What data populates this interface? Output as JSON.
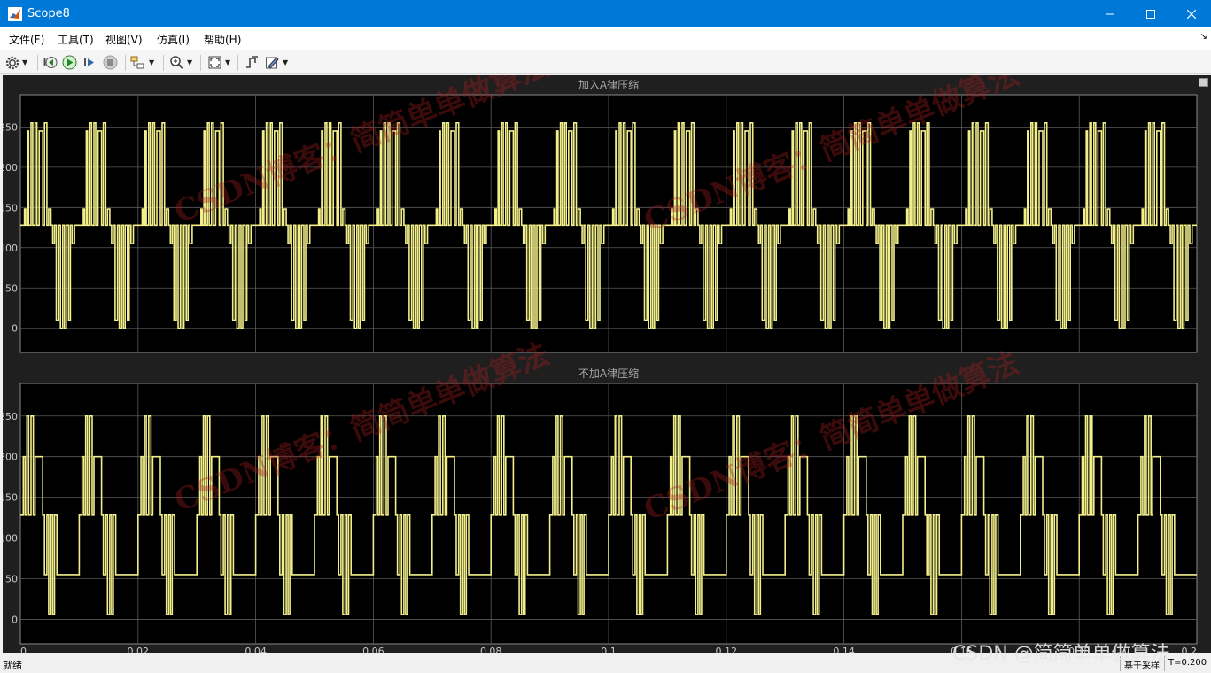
{
  "window": {
    "title": "Scope8"
  },
  "menu": [
    "文件(F)",
    "工具(T)",
    "视图(V)",
    "仿真(I)",
    "帮助(H)"
  ],
  "toolbar": {
    "buttons": [
      {
        "name": "settings-icon"
      },
      {
        "name": "step-back-icon"
      },
      {
        "name": "run-icon"
      },
      {
        "name": "step-forward-icon"
      },
      {
        "name": "stop-icon"
      },
      {
        "name": "highlight-block-icon"
      },
      {
        "name": "zoom-in-icon"
      },
      {
        "name": "autoscale-icon"
      },
      {
        "name": "triggers-icon"
      },
      {
        "name": "style-icon"
      }
    ]
  },
  "statusbar": {
    "status": "就绪",
    "sample_mode": "基于采样",
    "time": "T=0.200"
  },
  "watermark": {
    "page_text": "CSDN @简简单单做算法",
    "diagonal_text": "CSDN博客：简简单单做算法"
  },
  "colors": {
    "trace": "#f2ef8a",
    "plot_bg": "#000000",
    "panel_bg": "#1f1f1f",
    "grid": "#5a5a5a",
    "titlebar": "#0078d7"
  },
  "chart_data": [
    {
      "type": "line",
      "title": "加入A律压缩",
      "xlim": [
        0,
        0.2
      ],
      "ylim": [
        -30,
        290
      ],
      "y_ticks": [
        0,
        50,
        100,
        150,
        200,
        250
      ],
      "grid": true,
      "period": 0.02,
      "period_shape": {
        "x": [
          0,
          0.0007,
          0.0007,
          0.0009,
          0.0009,
          0.0012,
          0.0012,
          0.0014,
          0.0014,
          0.0018,
          0.0018,
          0.0021,
          0.0021,
          0.0025,
          0.0025,
          0.0028,
          0.0028,
          0.0032,
          0.0032,
          0.0038,
          0.0038,
          0.0041,
          0.0041,
          0.0045,
          0.0045,
          0.0048,
          0.0048,
          0.0052,
          0.0052,
          0.0055,
          0.0055,
          0.0058,
          0.0058,
          0.0061,
          0.0061,
          0.0065,
          0.0065,
          0.0068,
          0.0068,
          0.0072,
          0.0072,
          0.0075,
          0.0075,
          0.0078,
          0.0078,
          0.0082,
          0.0082,
          0.0085,
          0.0085,
          0.0088,
          0.0088,
          0.0092,
          0.0092,
          0.01,
          0.01,
          0.0107,
          0.0107,
          0.0109,
          0.0109,
          0.0112,
          0.0112,
          0.0114,
          0.0114,
          0.0118,
          0.0118,
          0.0121,
          0.0121,
          0.0125,
          0.0125,
          0.0128,
          0.0128,
          0.0132,
          0.0132,
          0.0138,
          0.0138,
          0.0141,
          0.0141,
          0.0145,
          0.0145,
          0.0148,
          0.0148,
          0.0152,
          0.0152,
          0.0155,
          0.0155,
          0.0158,
          0.0158,
          0.0161,
          0.0161,
          0.0165,
          0.0165,
          0.0168,
          0.0168,
          0.0172,
          0.0172,
          0.0175,
          0.0175,
          0.0178,
          0.0178,
          0.0182,
          0.0182,
          0.0185,
          0.0185,
          0.0188,
          0.0188,
          0.0192,
          0.0192,
          0.02
        ],
        "y": [
          128,
          128,
          148,
          148,
          128,
          128,
          245,
          245,
          128,
          128,
          255,
          255,
          128,
          128,
          255,
          255,
          128,
          128,
          245,
          245,
          128,
          128,
          255,
          255,
          128,
          128,
          148,
          148,
          128,
          128,
          105,
          105,
          128,
          128,
          10,
          10,
          128,
          128,
          0,
          0,
          128,
          128,
          0,
          0,
          128,
          128,
          10,
          10,
          128,
          128,
          105,
          105,
          128,
          128,
          128,
          128,
          148,
          148,
          128,
          128,
          245,
          245,
          128,
          128,
          255,
          255,
          128,
          128,
          255,
          255,
          128,
          128,
          245,
          245,
          128,
          128,
          255,
          255,
          128,
          128,
          148,
          148,
          128,
          128,
          105,
          105,
          128,
          128,
          10,
          10,
          128,
          128,
          0,
          0,
          128,
          128,
          0,
          0,
          128,
          128,
          10,
          10,
          128,
          128,
          105,
          105,
          128,
          128
        ]
      }
    },
    {
      "type": "line",
      "title": "不加A律压缩",
      "xlim": [
        0,
        0.2
      ],
      "ylim": [
        -30,
        290
      ],
      "y_ticks": [
        0,
        50,
        100,
        150,
        200,
        250
      ],
      "x_ticks": [
        0,
        0.02,
        0.04,
        0.06,
        0.08,
        0.1,
        0.12,
        0.14,
        0.16,
        0.18,
        0.2
      ],
      "grid": true,
      "period": 0.01,
      "period_shape": {
        "x": [
          0,
          0.0005,
          0.0005,
          0.0008,
          0.0008,
          0.0011,
          0.0011,
          0.0014,
          0.0014,
          0.0018,
          0.0018,
          0.0022,
          0.0022,
          0.0025,
          0.0025,
          0.0038,
          0.0038,
          0.0041,
          0.0041,
          0.0045,
          0.0045,
          0.0048,
          0.0048,
          0.0052,
          0.0052,
          0.0055,
          0.0055,
          0.0058,
          0.0058,
          0.0062,
          0.0062,
          0.01
        ],
        "y": [
          128,
          128,
          200,
          200,
          128,
          128,
          250,
          250,
          128,
          128,
          250,
          250,
          128,
          128,
          200,
          200,
          128,
          128,
          55,
          55,
          128,
          128,
          6,
          6,
          128,
          128,
          6,
          6,
          128,
          128,
          55,
          55
        ]
      }
    }
  ]
}
